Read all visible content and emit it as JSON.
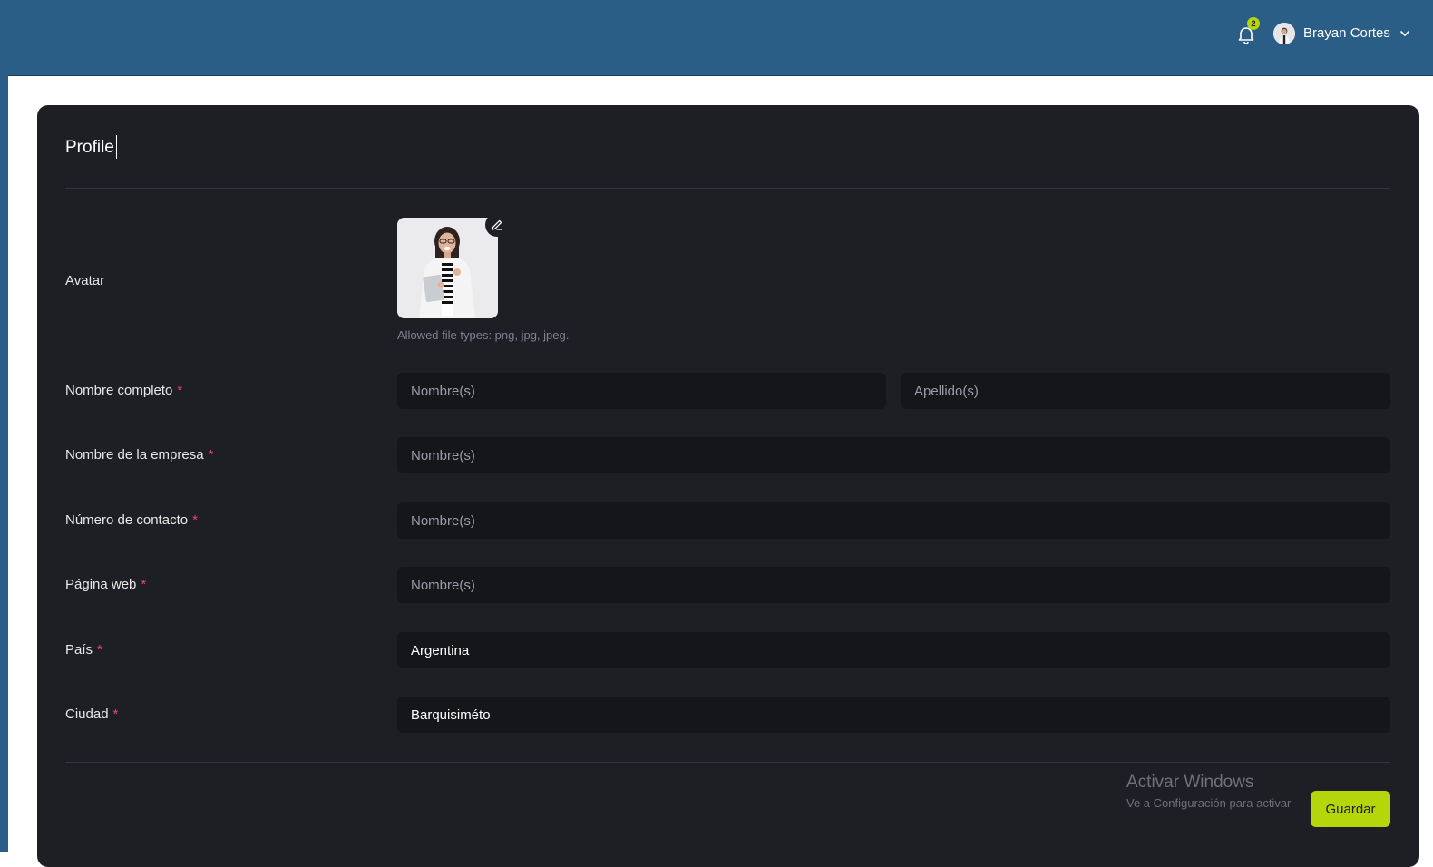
{
  "header": {
    "notifications_count": "2",
    "user_name": "Brayan Cortes",
    "colors": {
      "bar": "#2b5e87",
      "badge": "#b4d60b"
    },
    "icons": [
      "bell-icon",
      "chevron-down-icon"
    ]
  },
  "card": {
    "title": "Profile"
  },
  "form": {
    "avatar": {
      "label": "Avatar",
      "hint": "Allowed file types: png, jpg, jpeg.",
      "edit_icon": "pencil-icon"
    },
    "full_name": {
      "label": "Nombre completo",
      "required_mark": "*",
      "first_placeholder": "Nombre(s)",
      "last_placeholder": "Apellido(s)",
      "first_value": "",
      "last_value": ""
    },
    "company": {
      "label": "Nombre de la empresa",
      "required_mark": "*",
      "placeholder": "Nombre(s)",
      "value": ""
    },
    "phone": {
      "label": "Número de contacto",
      "required_mark": "*",
      "placeholder": "Nombre(s)",
      "value": ""
    },
    "website": {
      "label": "Página web",
      "required_mark": "*",
      "placeholder": "Nombre(s)",
      "value": ""
    },
    "country": {
      "label": "País",
      "required_mark": "*",
      "value": "Argentina"
    },
    "city": {
      "label": "Ciudad",
      "required_mark": "*",
      "value": "Barquisiméto"
    }
  },
  "actions": {
    "save_label": "Guardar",
    "color": "#b4d60b"
  },
  "watermark": {
    "title": "Activar Windows",
    "subtitle": "Ve a Configuración para activar"
  }
}
